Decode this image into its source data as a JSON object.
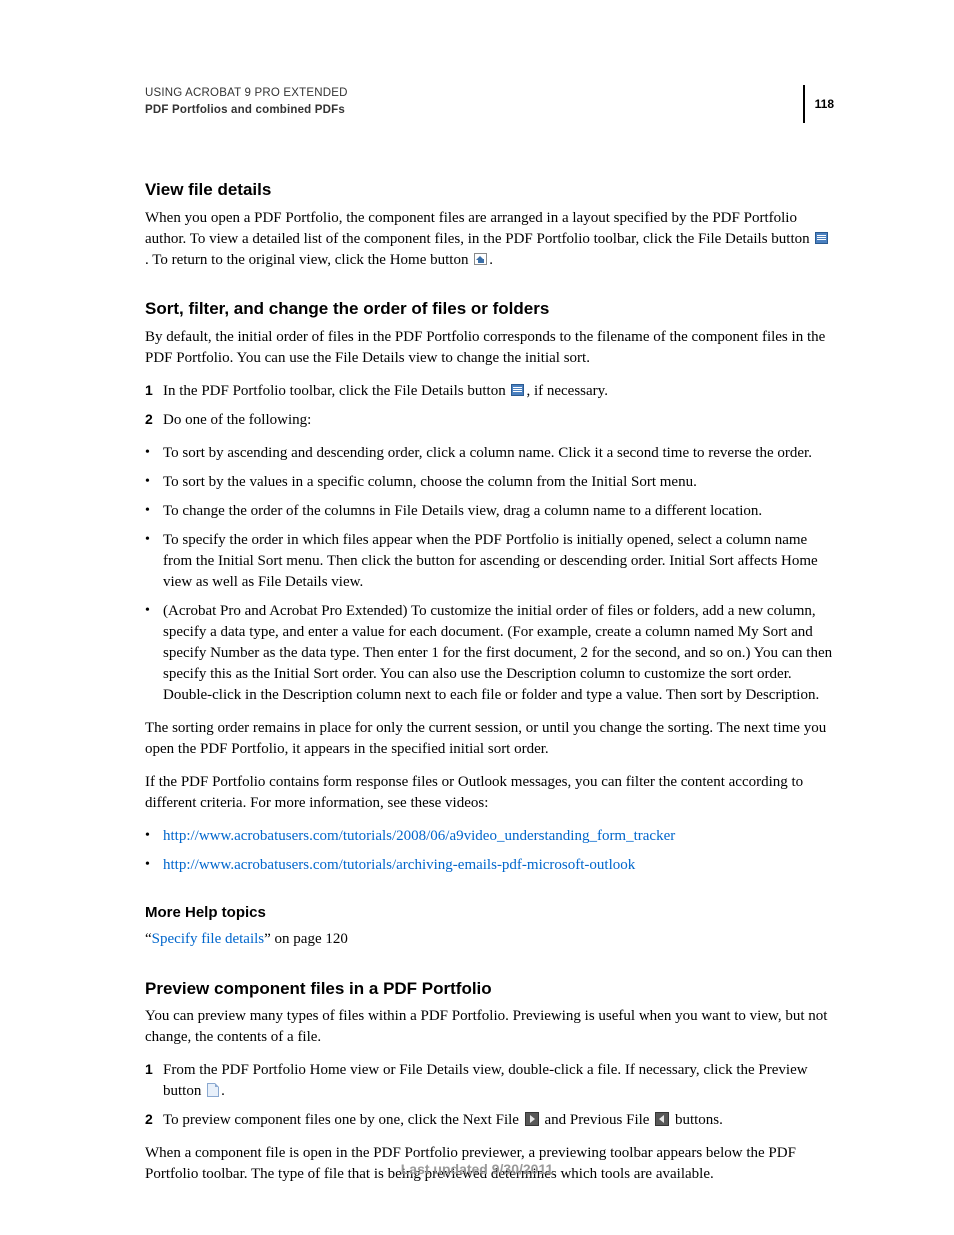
{
  "header": {
    "doc_title": "USING ACROBAT 9 PRO EXTENDED",
    "section_title": "PDF Portfolios and combined PDFs",
    "page_number": "118"
  },
  "s1": {
    "heading": "View file details",
    "p1a": "When you open a PDF Portfolio, the component files are arranged in a layout specified by the PDF Portfolio author. To view a detailed list of the component files, in the PDF Portfolio toolbar, click the File Details button ",
    "p1b": ". To return to the original view, click the Home button ",
    "p1c": "."
  },
  "s2": {
    "heading": "Sort, filter, and change the order of files or folders",
    "p1": "By default, the initial order of files in the PDF Portfolio corresponds to the filename of the component files in the PDF Portfolio. You can use the File Details view to change the initial sort.",
    "step1a": "In the PDF Portfolio toolbar, click the File Details button ",
    "step1b": ", if necessary.",
    "step2": "Do one of the following:",
    "b1": "To sort by ascending and descending order, click a column name. Click it a second time to reverse the order.",
    "b2": "To sort by the values in a specific column, choose the column from the Initial Sort menu.",
    "b3": "To change the order of the columns in File Details view, drag a column name to a different location.",
    "b4": "To specify the order in which files appear when the PDF Portfolio is initially opened, select a column name from the Initial Sort menu. Then click the button for ascending or descending order. Initial Sort affects Home view as well as File Details view.",
    "b5": "(Acrobat Pro and Acrobat Pro Extended) To customize the initial order of files or folders, add a new column, specify a data type, and enter a value for each document. (For example, create a column named My Sort and specify Number as the data type. Then enter 1 for the first document, 2 for the second, and so on.) You can then specify this as the Initial Sort order. You can also use the Description column to customize the sort order. Double-click in the Description column next to each file or folder and type a value. Then sort by Description.",
    "p2": "The sorting order remains in place for only the current session, or until you change the sorting. The next time you open the PDF Portfolio, it appears in the specified initial sort order.",
    "p3": "If the PDF Portfolio contains form response files or Outlook messages, you can filter the content according to different criteria. For more information, see these videos:",
    "link1": "http://www.acrobatusers.com/tutorials/2008/06/a9video_understanding_form_tracker",
    "link2": "http://www.acrobatusers.com/tutorials/archiving-emails-pdf-microsoft-outlook"
  },
  "help": {
    "heading": "More Help topics",
    "q1": "“",
    "link": "Specify file details",
    "q2": "” on page 120"
  },
  "s3": {
    "heading": "Preview component files in a PDF Portfolio",
    "p1": "You can preview many types of files within a PDF Portfolio. Previewing is useful when you want to view, but not change, the contents of a file.",
    "step1a": "From the PDF Portfolio Home view or File Details view, double-click a file. If necessary, click the Preview button ",
    "step1b": ".",
    "step2a": "To preview component files one by one, click the Next File ",
    "step2b": " and Previous File ",
    "step2c": " buttons.",
    "p2": "When a component file is open in the PDF Portfolio previewer, a previewing toolbar appears below the PDF Portfolio toolbar. The type of file that is being previewed determines which tools are available."
  },
  "footer": {
    "updated": "Last updated 9/30/2011"
  }
}
